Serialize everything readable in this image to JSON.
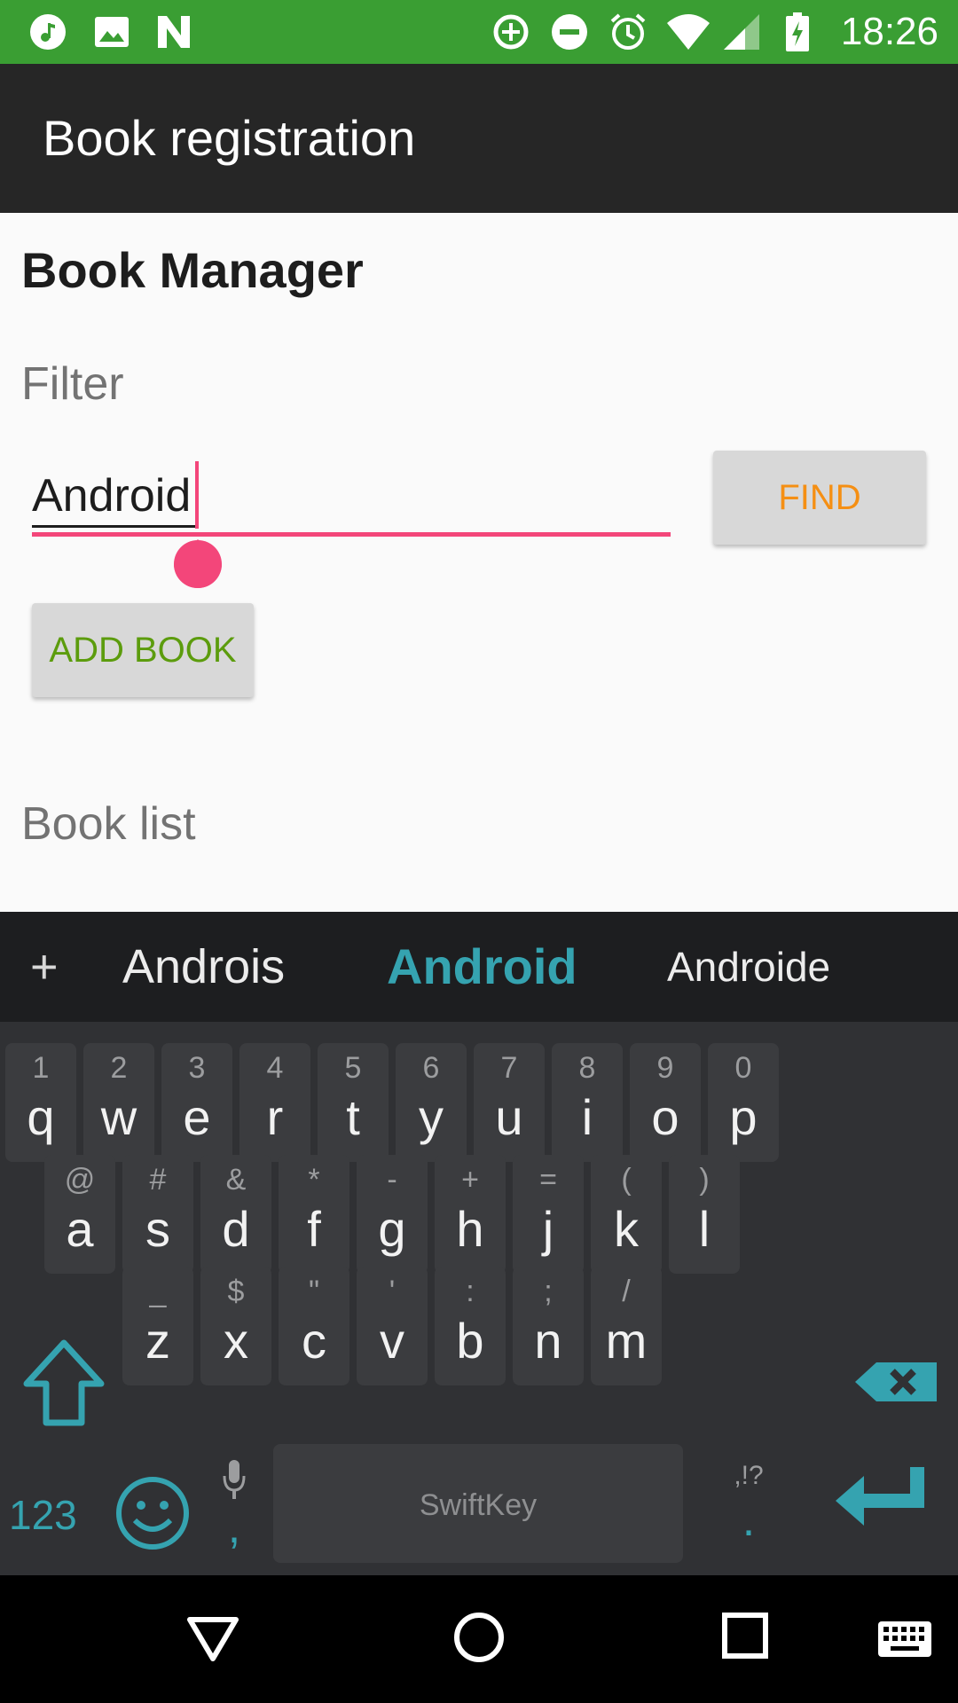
{
  "status_bar": {
    "time": "18:26",
    "left_icons": [
      "music-note-icon",
      "image-icon",
      "n-app-icon"
    ],
    "right_icons": [
      "data-saver-icon",
      "do-not-disturb-icon",
      "alarm-icon",
      "wifi-icon",
      "cell-signal-icon",
      "battery-charging-icon"
    ],
    "color": "#3a9e33"
  },
  "toolbar": {
    "title": "Book registration",
    "color": "#262626"
  },
  "content": {
    "heading": "Book Manager",
    "filter_label": "Filter",
    "filter_value": "Android",
    "find_label": "FIND",
    "add_book_label": "ADD BOOK",
    "book_list_label": "Book list",
    "accent_color": "#f3467a",
    "find_color": "#f58f13",
    "add_color": "#5c9c0d"
  },
  "keyboard": {
    "suggestions": {
      "plus": "+",
      "left": "Androis",
      "center": "Android",
      "right": "Androide"
    },
    "row1": [
      {
        "pri": "q",
        "sec": "1"
      },
      {
        "pri": "w",
        "sec": "2"
      },
      {
        "pri": "e",
        "sec": "3"
      },
      {
        "pri": "r",
        "sec": "4"
      },
      {
        "pri": "t",
        "sec": "5"
      },
      {
        "pri": "y",
        "sec": "6"
      },
      {
        "pri": "u",
        "sec": "7"
      },
      {
        "pri": "i",
        "sec": "8"
      },
      {
        "pri": "o",
        "sec": "9"
      },
      {
        "pri": "p",
        "sec": "0"
      }
    ],
    "row2": [
      {
        "pri": "a",
        "sec": "@"
      },
      {
        "pri": "s",
        "sec": "#"
      },
      {
        "pri": "d",
        "sec": "&"
      },
      {
        "pri": "f",
        "sec": "*"
      },
      {
        "pri": "g",
        "sec": "-"
      },
      {
        "pri": "h",
        "sec": "+"
      },
      {
        "pri": "j",
        "sec": "="
      },
      {
        "pri": "k",
        "sec": "("
      },
      {
        "pri": "l",
        "sec": ")"
      }
    ],
    "row3": [
      {
        "pri": "z",
        "sec": "_"
      },
      {
        "pri": "x",
        "sec": "$"
      },
      {
        "pri": "c",
        "sec": "\""
      },
      {
        "pri": "v",
        "sec": "'"
      },
      {
        "pri": "b",
        "sec": ":"
      },
      {
        "pri": "n",
        "sec": ";"
      },
      {
        "pri": "m",
        "sec": "/"
      }
    ],
    "num_label": "123",
    "comma": ",",
    "space_label": "SwiftKey",
    "punct_sec": ",!?",
    "period": ".",
    "accent_color": "#35a3b0"
  },
  "nav_bar": {
    "icons": [
      "back-icon",
      "home-icon",
      "recents-icon",
      "keyboard-switch-icon"
    ]
  }
}
